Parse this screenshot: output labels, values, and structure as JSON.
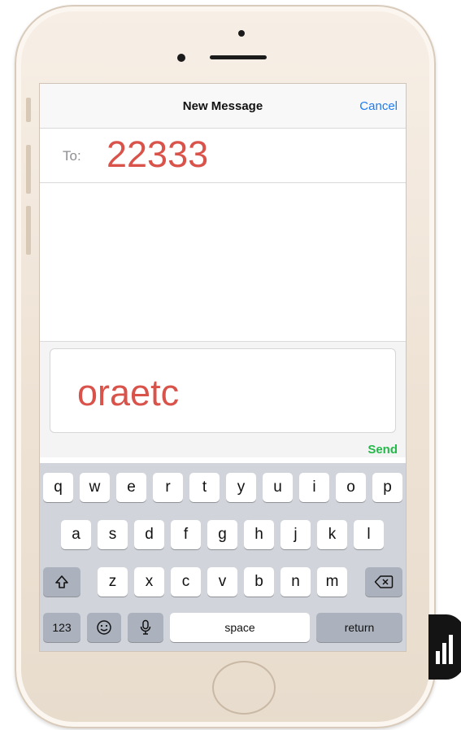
{
  "navbar": {
    "title": "New Message",
    "cancel_label": "Cancel"
  },
  "recipient": {
    "label": "To:",
    "value": "22333"
  },
  "compose": {
    "text": "oraetc",
    "send_label": "Send"
  },
  "keyboard": {
    "row1": [
      "q",
      "w",
      "e",
      "r",
      "t",
      "y",
      "u",
      "i",
      "o",
      "p"
    ],
    "row2": [
      "a",
      "s",
      "d",
      "f",
      "g",
      "h",
      "j",
      "k",
      "l"
    ],
    "row3": [
      "z",
      "x",
      "c",
      "v",
      "b",
      "n",
      "m"
    ],
    "shift_icon": "shift-arrow",
    "delete_icon": "backspace",
    "numbers_label": "123",
    "emoji_icon": "smiley-face",
    "mic_icon": "microphone",
    "space_label": "space",
    "return_label": "return"
  },
  "colors": {
    "accent": "#1d7cf2",
    "send": "#25b84a",
    "entered_text": "#d9534a"
  }
}
